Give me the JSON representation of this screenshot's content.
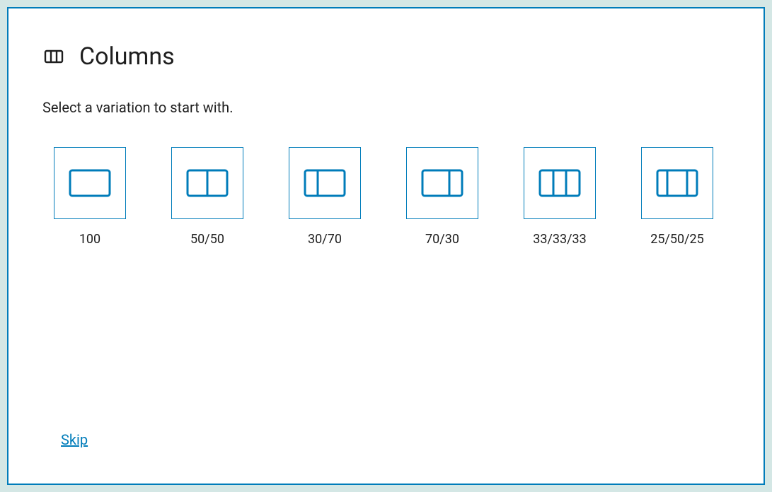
{
  "title": "Columns",
  "instruction": "Select a variation to start with.",
  "variations": [
    {
      "label": "100"
    },
    {
      "label": "50/50"
    },
    {
      "label": "30/70"
    },
    {
      "label": "70/30"
    },
    {
      "label": "33/33/33"
    },
    {
      "label": "25/50/25"
    }
  ],
  "skip_label": "Skip",
  "colors": {
    "accent": "#007cba"
  }
}
